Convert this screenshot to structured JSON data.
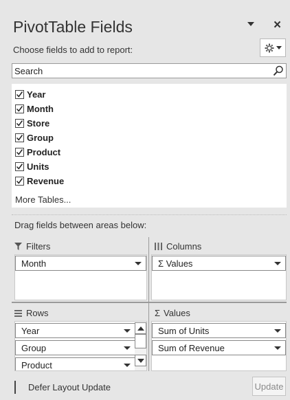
{
  "panel": {
    "title": "PivotTable Fields",
    "close_label": "×",
    "subtitle": "Choose fields to add to report:",
    "settings_icon": "gear-icon"
  },
  "search": {
    "placeholder": "Search",
    "icon": "search-icon"
  },
  "fields": [
    {
      "label": "Year",
      "checked": true
    },
    {
      "label": "Month",
      "checked": true
    },
    {
      "label": "Store",
      "checked": true
    },
    {
      "label": "Group",
      "checked": true
    },
    {
      "label": "Product",
      "checked": true
    },
    {
      "label": "Units",
      "checked": true
    },
    {
      "label": "Revenue",
      "checked": true
    }
  ],
  "more_tables": "More Tables...",
  "drag_hint": "Drag fields between areas below:",
  "areas": {
    "filters": {
      "title": "Filters",
      "icon": "filter-icon",
      "items": [
        "Month"
      ]
    },
    "columns": {
      "title": "Columns",
      "icon": "columns-icon",
      "items": [
        "Σ Values"
      ]
    },
    "rows": {
      "title": "Rows",
      "icon": "rows-icon",
      "items": [
        "Year",
        "Group",
        "Product"
      ]
    },
    "values": {
      "title": "Values",
      "icon": "sigma-icon",
      "title_prefix": "Σ",
      "items": [
        "Sum of Units",
        "Sum of Revenue"
      ]
    }
  },
  "footer": {
    "defer_label": "Defer Layout Update",
    "defer_checked": false,
    "update_label": "Update"
  },
  "colors": {
    "panel_bg": "#e6e6e6",
    "box_bg": "#ffffff",
    "disabled_text": "#8a8a8a"
  }
}
